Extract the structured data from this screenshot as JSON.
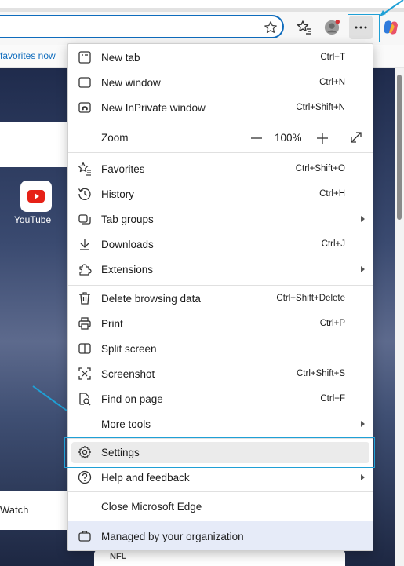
{
  "favorites_bar": {
    "link": "favorites now"
  },
  "page": {
    "tile_label": "YouTube",
    "watch_label": "Watch",
    "bottom_card_text": "NFL"
  },
  "menu": {
    "new_tab": {
      "label": "New tab",
      "shortcut": "Ctrl+T"
    },
    "new_window": {
      "label": "New window",
      "shortcut": "Ctrl+N"
    },
    "new_inprivate": {
      "label": "New InPrivate window",
      "shortcut": "Ctrl+Shift+N"
    },
    "zoom": {
      "label": "Zoom",
      "value": "100%"
    },
    "favorites": {
      "label": "Favorites",
      "shortcut": "Ctrl+Shift+O"
    },
    "history": {
      "label": "History",
      "shortcut": "Ctrl+H"
    },
    "tab_groups": {
      "label": "Tab groups"
    },
    "downloads": {
      "label": "Downloads",
      "shortcut": "Ctrl+J"
    },
    "extensions": {
      "label": "Extensions"
    },
    "delete_browsing": {
      "label": "Delete browsing data",
      "shortcut": "Ctrl+Shift+Delete"
    },
    "print": {
      "label": "Print",
      "shortcut": "Ctrl+P"
    },
    "split_screen": {
      "label": "Split screen"
    },
    "screenshot": {
      "label": "Screenshot",
      "shortcut": "Ctrl+Shift+S"
    },
    "find_on_page": {
      "label": "Find on page",
      "shortcut": "Ctrl+F"
    },
    "more_tools": {
      "label": "More tools"
    },
    "settings": {
      "label": "Settings"
    },
    "help": {
      "label": "Help and feedback"
    },
    "close_edge": {
      "label": "Close Microsoft Edge"
    },
    "managed": {
      "label": "Managed by your organization"
    }
  },
  "colors": {
    "accent": "#0f6cbd",
    "annotation": "#1fa0d6",
    "managed_bg": "#e6ebf8"
  }
}
